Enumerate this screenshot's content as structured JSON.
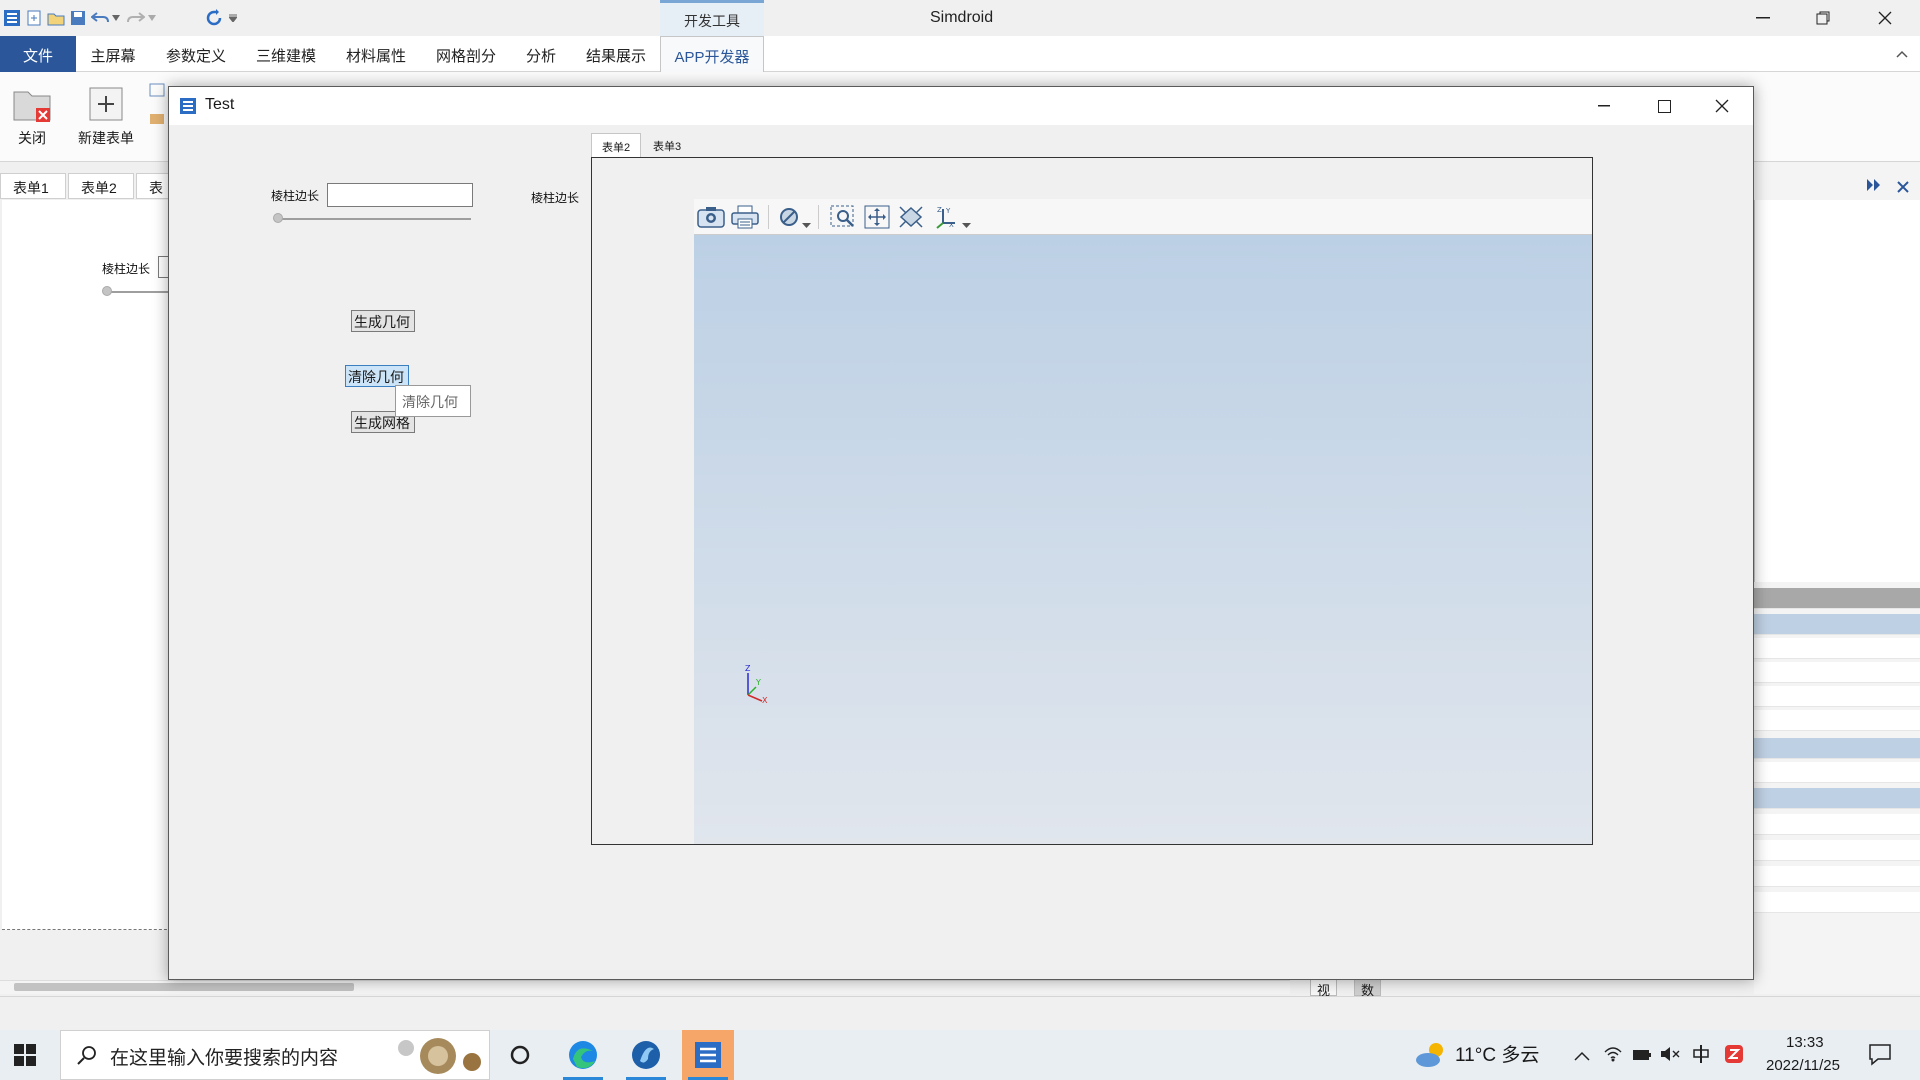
{
  "app": {
    "title": "Simdroid",
    "context_tab": "开发工具"
  },
  "menu": {
    "file": "文件",
    "tabs": [
      "主屏幕",
      "参数定义",
      "三维建模",
      "材料属性",
      "网格剖分",
      "分析",
      "结果展示",
      "APP开发器"
    ]
  },
  "ribbon": {
    "close_label": "关闭",
    "new_form_label": "新建表单"
  },
  "background": {
    "tabs": [
      "表单1",
      "表单2",
      "表"
    ],
    "label": "棱柱边长"
  },
  "bottom_tabs": [
    "视图",
    "数据"
  ],
  "dialog": {
    "title": "Test",
    "label_left": "棱柱边长",
    "input_value": "",
    "label_right": "棱柱边长",
    "buttons": {
      "generate_geometry": "生成几何",
      "clear_geometry": "清除几何",
      "generate_mesh": "生成网格"
    },
    "tooltip": "清除几何",
    "inner_tabs": [
      "表单2",
      "表单3"
    ],
    "axis": {
      "x": "X",
      "y": "Y",
      "z": "Z"
    }
  },
  "taskbar": {
    "search_placeholder": "在这里输入你要搜索的内容",
    "weather": "11°C 多云",
    "time": "13:33",
    "date": "2022/11/25"
  },
  "colors": {
    "brand": "#2b579a",
    "viewer_top": "#bcd0e5",
    "viewer_bottom": "#e1e6ed"
  }
}
